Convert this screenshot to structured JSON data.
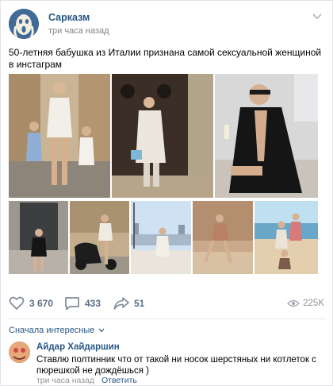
{
  "post": {
    "group_name": "Сарказм",
    "time": "три часа назад",
    "menu_icon": "chevron-down-icon",
    "text": "50-летняя бабушка из Италии признана самой сексуальной женщиной в инстаграм",
    "photos": [
      {
        "name": "photo-1",
        "desc": "woman with children on street"
      },
      {
        "name": "photo-2",
        "desc": "woman in white coat by door"
      },
      {
        "name": "photo-3",
        "desc": "woman in black lace"
      },
      {
        "name": "photo-4",
        "desc": "woman by wooden door"
      },
      {
        "name": "photo-5",
        "desc": "woman on scooter"
      },
      {
        "name": "photo-6",
        "desc": "woman on balcony"
      },
      {
        "name": "photo-7",
        "desc": "woman sitting on ledge"
      },
      {
        "name": "photo-8",
        "desc": "women on beach"
      }
    ]
  },
  "actions": {
    "likes": "3 670",
    "comments": "433",
    "shares": "51",
    "views": "225K"
  },
  "comments": {
    "sort_label": "Сначала интересные",
    "sort_icon": "chevron-down-icon",
    "items": [
      {
        "author": "Айдар Хайдаршин",
        "text": "Ставлю полтинник что от такой ни носок шерстяных ни котлеток с пюрешкой не дождёшься )",
        "time": "три часа назад",
        "reply_label": "Ответить"
      }
    ]
  },
  "colors": {
    "link": "#2a5885",
    "action": "#5a6e86",
    "muted": "#939393"
  }
}
